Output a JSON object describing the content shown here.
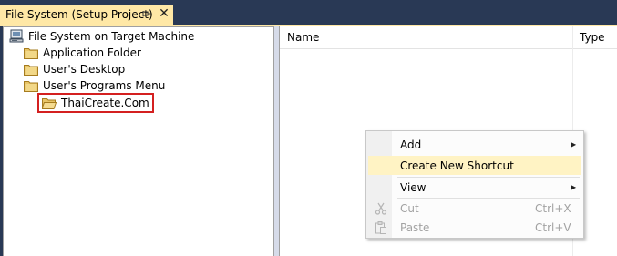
{
  "tab": {
    "title": "File System (Setup Project)",
    "pin_glyph": "⊣",
    "close_glyph": "✕"
  },
  "tree": {
    "root": "File System on Target Machine",
    "items": [
      {
        "label": "Application Folder",
        "icon": "folder-icon"
      },
      {
        "label": "User's Desktop",
        "icon": "folder-icon"
      },
      {
        "label": "User's Programs Menu",
        "icon": "folder-icon"
      }
    ],
    "selected_child": {
      "label": "ThaiCreate.Com",
      "icon": "folder-open-icon"
    }
  },
  "list": {
    "columns": [
      "Name",
      "Type"
    ]
  },
  "context_menu": {
    "items": [
      {
        "label": "Add",
        "shortcut": "",
        "submenu": true,
        "enabled": true,
        "highlighted": false
      },
      {
        "label": "Create New Shortcut",
        "shortcut": "",
        "submenu": false,
        "enabled": true,
        "highlighted": true
      },
      {
        "label": "View",
        "shortcut": "",
        "submenu": true,
        "enabled": true,
        "highlighted": false
      },
      {
        "label": "Cut",
        "shortcut": "Ctrl+X",
        "submenu": false,
        "enabled": false,
        "highlighted": false,
        "icon": "scissors-icon"
      },
      {
        "label": "Paste",
        "shortcut": "Ctrl+V",
        "submenu": false,
        "enabled": false,
        "highlighted": false,
        "icon": "paste-icon"
      }
    ]
  },
  "colors": {
    "background": "#293955",
    "tab_active": "#ffe8a6",
    "selection_outline": "#d42020",
    "menu_highlight": "#fff3c4",
    "disabled_text": "#a2a2a2"
  }
}
